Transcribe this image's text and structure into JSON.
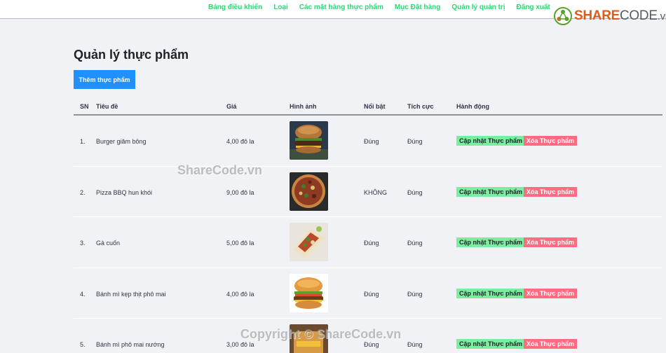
{
  "nav": {
    "items": [
      "Bảng điều khiển",
      "Loại",
      "Các mặt hàng thực phẩm",
      "Mục Đặt hàng",
      "Quản lý quản trị",
      "Đăng xuất"
    ]
  },
  "logo": {
    "brand": "SHARE",
    "brand_dim": "CODE",
    "tld": ".vn"
  },
  "page": {
    "title": "Quản lý thực phẩm",
    "add_button": "Thêm thực phẩm"
  },
  "table": {
    "headers": {
      "sn": "SN",
      "title": "Tiêu đề",
      "price": "Giá",
      "image": "Hình ảnh",
      "featured": "Nổi bật",
      "active": "Tích cực",
      "actions": "Hành động"
    },
    "rows": [
      {
        "sn": "1.",
        "title": "Burger giăm bông",
        "price": "4,00 đô la",
        "featured": "Đúng",
        "active": "Đúng",
        "image_icon": "burger-photo"
      },
      {
        "sn": "2.",
        "title": "Pizza BBQ hun khói",
        "price": "9,00 đô la",
        "featured": "KHÔNG",
        "active": "Đúng",
        "image_icon": "pizza-photo"
      },
      {
        "sn": "3.",
        "title": "Gà cuốn",
        "price": "5,00 đô la",
        "featured": "Đúng",
        "active": "Đúng",
        "image_icon": "wrap-photo"
      },
      {
        "sn": "4.",
        "title": "Bánh mì kẹp thịt phô mai",
        "price": "4,00 đô la",
        "featured": "Đúng",
        "active": "Đúng",
        "image_icon": "cheeseburger-photo"
      },
      {
        "sn": "5.",
        "title": "Bánh mì phô mai nướng",
        "price": "3,00 đô la",
        "featured": "Đúng",
        "active": "Đúng",
        "image_icon": "grilled-cheese-photo"
      }
    ],
    "update_label": "Cập nhật Thực phẩm",
    "delete_label": "Xóa Thực phẩm"
  },
  "watermarks": {
    "middle": "ShareCode.vn",
    "bottom": "Copyright © ShareCode.vn"
  },
  "colors": {
    "nav_link": "#2ed573",
    "primary_button": "#1e90ff",
    "update_button": "#7bed9f",
    "delete_button": "#ff6b81",
    "background": "#f1f2f6"
  }
}
